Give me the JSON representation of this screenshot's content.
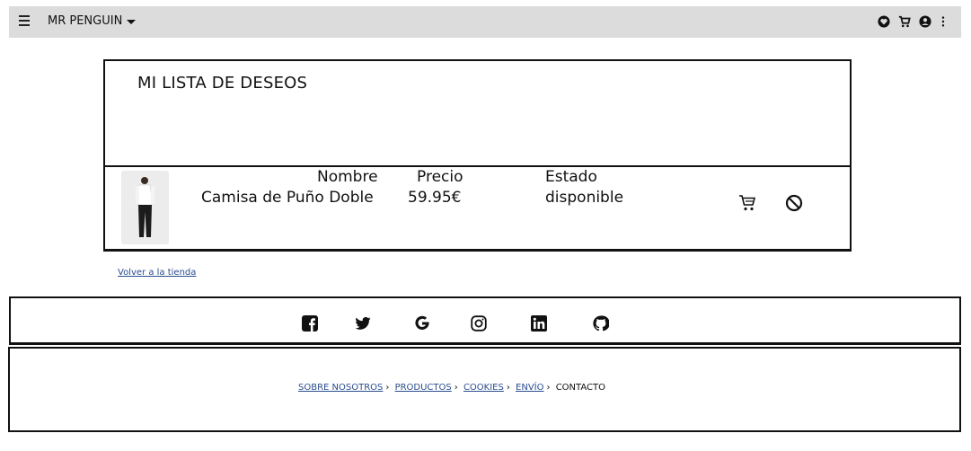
{
  "header": {
    "brand": "MR PENGUIN",
    "icons": [
      "menu-icon",
      "heart-icon",
      "cart-icon",
      "user-icon",
      "more-vertical-icon"
    ]
  },
  "wishlist": {
    "title": "MI LISTA DE DESEOS",
    "columns": {
      "name": "Nombre",
      "price": "Precio",
      "status": "Estado"
    },
    "items": [
      {
        "name": "Camisa de Puño Doble",
        "price": "59.95€",
        "status": "disponible"
      }
    ],
    "actions": [
      "cart-icon",
      "block-icon"
    ]
  },
  "back_link": "Volver a la tienda",
  "social": [
    "facebook-icon",
    "twitter-icon",
    "google-icon",
    "instagram-icon",
    "linkedin-icon",
    "github-icon"
  ],
  "footer_nav": {
    "separator": "›",
    "links": [
      "SOBRE NOSOTROS",
      "PRODUCTOS",
      "COOKIES",
      "ENVÍO"
    ],
    "current": "CONTACTO"
  }
}
